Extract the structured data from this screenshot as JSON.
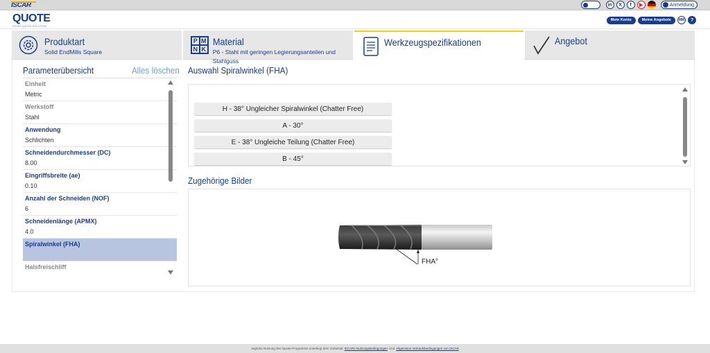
{
  "topbar": {
    "brand": "ISCAR",
    "social": [
      "in",
      "X",
      "f",
      "▶"
    ],
    "login_label": "Anmeldung"
  },
  "header": {
    "logo": "QUOTE",
    "logo_sub": "ISCAR QUOTE SOLUTION",
    "my_account": "Mein Konto",
    "my_quotes": "Meine Angebote",
    "units": "MM",
    "help": "?"
  },
  "tabs": [
    {
      "title": "Produktart",
      "subtitle": "Solid EndMills Square",
      "icon": "gear-circle-icon"
    },
    {
      "title": "Material",
      "subtitle": "P6 - Stahl mit geringen Legierungsanteilen und Stahlguss",
      "icon": "pmnk-icon",
      "pmnk": [
        "P",
        "M",
        "N",
        "K"
      ]
    },
    {
      "title": "Werkzeugspezifikationen",
      "subtitle": "",
      "icon": "document-icon"
    },
    {
      "title": "Angebot",
      "subtitle": "",
      "icon": "checkmark-icon"
    }
  ],
  "params": {
    "title": "Parameterübersicht",
    "clear": "Alles löschen",
    "items": [
      {
        "label": "Einheit",
        "value": "Metric",
        "grey": true
      },
      {
        "label": "Werkstoff",
        "value": "Stahl",
        "grey": true
      },
      {
        "label": "Anwendung",
        "value": "Schlichten",
        "grey": false
      },
      {
        "label": "Schneidendurchmesser (DC)",
        "value": "8.00",
        "grey": false
      },
      {
        "label": "Eingriffsbreite (ae)",
        "value": "0.10",
        "grey": false
      },
      {
        "label": "Anzahl der Schneiden (NOF)",
        "value": "6",
        "grey": false
      },
      {
        "label": "Schneidenlänge (APMX)",
        "value": "4.0",
        "grey": false
      },
      {
        "label": "Spiralwinkel (FHA)",
        "value": "",
        "grey": false,
        "selected": true
      },
      {
        "label": "Halsfreischliff",
        "value": "",
        "grey": true
      }
    ]
  },
  "selection": {
    "title": "Auswahl Spiralwinkel (FHA)",
    "options": [
      "H  -  38° Ungleicher Spiralwinkel (Chatter Free)",
      "A  -  30°",
      "E  -  38° Ungleiche Teilung (Chatter Free)",
      "B  -  45°"
    ]
  },
  "images": {
    "title": "Zugehörige Bilder",
    "callout": "FHA°"
  },
  "footer": {
    "text1": "Jegliche Nutzung des iQuote-Programms unterliegt dem Vorbehalt",
    "link1": "ISCARs Nutzungsbedingungen",
    "text2": "Und",
    "link2": "Allgemeine Verkaufsbedingungen von ISCAR"
  },
  "colors": {
    "brand_blue": "#1a3c8c",
    "accent_yellow": "#f2d300",
    "selected_row": "#b8c5e0"
  }
}
